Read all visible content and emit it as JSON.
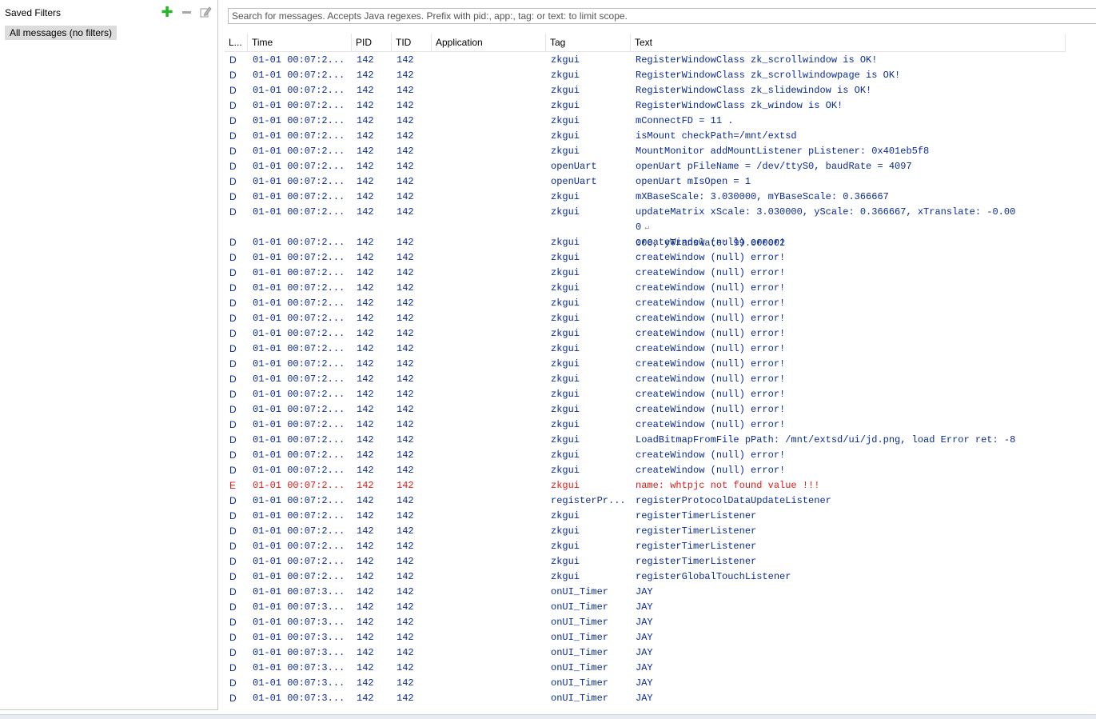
{
  "saved_filters": {
    "title": "Saved Filters",
    "items": [
      "All messages (no filters)"
    ]
  },
  "search": {
    "placeholder": "Search for messages. Accepts Java regexes. Prefix with pid:, app:, tag: or text: to limit scope."
  },
  "columns": {
    "level": "L...",
    "time": "Time",
    "pid": "PID",
    "tid": "TID",
    "application": "Application",
    "tag": "Tag",
    "text": "Text"
  },
  "colors": {
    "debug": "#0a2b96",
    "error": "#e01b1b",
    "add_icon": "#27b327"
  },
  "icons": {
    "add": "plus-icon",
    "remove": "minus-icon",
    "edit": "edit-icon",
    "wrap": "line-wrap-icon"
  },
  "rows": [
    {
      "level": "D",
      "time": "01-01 00:07:2...",
      "pid": "142",
      "tid": "142",
      "app": "",
      "tag": "zkgui",
      "text": "RegisterWindowClass zk_scrollwindow is OK!"
    },
    {
      "level": "D",
      "time": "01-01 00:07:2...",
      "pid": "142",
      "tid": "142",
      "app": "",
      "tag": "zkgui",
      "text": "RegisterWindowClass zk_scrollwindowpage is OK!"
    },
    {
      "level": "D",
      "time": "01-01 00:07:2...",
      "pid": "142",
      "tid": "142",
      "app": "",
      "tag": "zkgui",
      "text": "RegisterWindowClass zk_slidewindow is OK!"
    },
    {
      "level": "D",
      "time": "01-01 00:07:2...",
      "pid": "142",
      "tid": "142",
      "app": "",
      "tag": "zkgui",
      "text": "RegisterWindowClass zk_window is OK!"
    },
    {
      "level": "D",
      "time": "01-01 00:07:2...",
      "pid": "142",
      "tid": "142",
      "app": "",
      "tag": "zkgui",
      "text": "mConnectFD = 11 ."
    },
    {
      "level": "D",
      "time": "01-01 00:07:2...",
      "pid": "142",
      "tid": "142",
      "app": "",
      "tag": "zkgui",
      "text": "isMount checkPath=/mnt/extsd"
    },
    {
      "level": "D",
      "time": "01-01 00:07:2...",
      "pid": "142",
      "tid": "142",
      "app": "",
      "tag": "zkgui",
      "text": "MountMonitor addMountListener pListener: 0x401eb5f8"
    },
    {
      "level": "D",
      "time": "01-01 00:07:2...",
      "pid": "142",
      "tid": "142",
      "app": "",
      "tag": "openUart",
      "text": "openUart pFileName = /dev/ttyS0, baudRate = 4097"
    },
    {
      "level": "D",
      "time": "01-01 00:07:2...",
      "pid": "142",
      "tid": "142",
      "app": "",
      "tag": "openUart",
      "text": "openUart mIsOpen = 1"
    },
    {
      "level": "D",
      "time": "01-01 00:07:2...",
      "pid": "142",
      "tid": "142",
      "app": "",
      "tag": "zkgui",
      "text": "mXBaseScale: 3.030000, mYBaseScale: 0.366667"
    },
    {
      "level": "D",
      "time": "01-01 00:07:2...",
      "pid": "142",
      "tid": "142",
      "app": "",
      "tag": "zkgui",
      "text": "updateMatrix xScale: 3.030000, yScale: 0.366667, xTranslate: -0.000",
      "text2": "000, yTranslate: 99.000002"
    },
    {
      "level": "D",
      "time": "01-01 00:07:2...",
      "pid": "142",
      "tid": "142",
      "app": "",
      "tag": "zkgui",
      "text": "createWindow (null) error!"
    },
    {
      "level": "D",
      "time": "01-01 00:07:2...",
      "pid": "142",
      "tid": "142",
      "app": "",
      "tag": "zkgui",
      "text": "createWindow (null) error!"
    },
    {
      "level": "D",
      "time": "01-01 00:07:2...",
      "pid": "142",
      "tid": "142",
      "app": "",
      "tag": "zkgui",
      "text": "createWindow (null) error!"
    },
    {
      "level": "D",
      "time": "01-01 00:07:2...",
      "pid": "142",
      "tid": "142",
      "app": "",
      "tag": "zkgui",
      "text": "createWindow (null) error!"
    },
    {
      "level": "D",
      "time": "01-01 00:07:2...",
      "pid": "142",
      "tid": "142",
      "app": "",
      "tag": "zkgui",
      "text": "createWindow (null) error!"
    },
    {
      "level": "D",
      "time": "01-01 00:07:2...",
      "pid": "142",
      "tid": "142",
      "app": "",
      "tag": "zkgui",
      "text": "createWindow (null) error!"
    },
    {
      "level": "D",
      "time": "01-01 00:07:2...",
      "pid": "142",
      "tid": "142",
      "app": "",
      "tag": "zkgui",
      "text": "createWindow (null) error!"
    },
    {
      "level": "D",
      "time": "01-01 00:07:2...",
      "pid": "142",
      "tid": "142",
      "app": "",
      "tag": "zkgui",
      "text": "createWindow (null) error!"
    },
    {
      "level": "D",
      "time": "01-01 00:07:2...",
      "pid": "142",
      "tid": "142",
      "app": "",
      "tag": "zkgui",
      "text": "createWindow (null) error!"
    },
    {
      "level": "D",
      "time": "01-01 00:07:2...",
      "pid": "142",
      "tid": "142",
      "app": "",
      "tag": "zkgui",
      "text": "createWindow (null) error!"
    },
    {
      "level": "D",
      "time": "01-01 00:07:2...",
      "pid": "142",
      "tid": "142",
      "app": "",
      "tag": "zkgui",
      "text": "createWindow (null) error!"
    },
    {
      "level": "D",
      "time": "01-01 00:07:2...",
      "pid": "142",
      "tid": "142",
      "app": "",
      "tag": "zkgui",
      "text": "createWindow (null) error!"
    },
    {
      "level": "D",
      "time": "01-01 00:07:2...",
      "pid": "142",
      "tid": "142",
      "app": "",
      "tag": "zkgui",
      "text": "createWindow (null) error!"
    },
    {
      "level": "D",
      "time": "01-01 00:07:2...",
      "pid": "142",
      "tid": "142",
      "app": "",
      "tag": "zkgui",
      "text": "LoadBitmapFromFile pPath: /mnt/extsd/ui/jd.png, load Error ret: -8"
    },
    {
      "level": "D",
      "time": "01-01 00:07:2...",
      "pid": "142",
      "tid": "142",
      "app": "",
      "tag": "zkgui",
      "text": "createWindow (null) error!"
    },
    {
      "level": "D",
      "time": "01-01 00:07:2...",
      "pid": "142",
      "tid": "142",
      "app": "",
      "tag": "zkgui",
      "text": "createWindow (null) error!"
    },
    {
      "level": "E",
      "time": "01-01 00:07:2...",
      "pid": "142",
      "tid": "142",
      "app": "",
      "tag": "zkgui",
      "text": "name: whtpjc not found value !!!"
    },
    {
      "level": "D",
      "time": "01-01 00:07:2...",
      "pid": "142",
      "tid": "142",
      "app": "",
      "tag": "registerPr...",
      "text": "registerProtocolDataUpdateListener"
    },
    {
      "level": "D",
      "time": "01-01 00:07:2...",
      "pid": "142",
      "tid": "142",
      "app": "",
      "tag": "zkgui",
      "text": "registerTimerListener"
    },
    {
      "level": "D",
      "time": "01-01 00:07:2...",
      "pid": "142",
      "tid": "142",
      "app": "",
      "tag": "zkgui",
      "text": "registerTimerListener"
    },
    {
      "level": "D",
      "time": "01-01 00:07:2...",
      "pid": "142",
      "tid": "142",
      "app": "",
      "tag": "zkgui",
      "text": "registerTimerListener"
    },
    {
      "level": "D",
      "time": "01-01 00:07:2...",
      "pid": "142",
      "tid": "142",
      "app": "",
      "tag": "zkgui",
      "text": "registerTimerListener"
    },
    {
      "level": "D",
      "time": "01-01 00:07:2...",
      "pid": "142",
      "tid": "142",
      "app": "",
      "tag": "zkgui",
      "text": "registerGlobalTouchListener"
    },
    {
      "level": "D",
      "time": "01-01 00:07:3...",
      "pid": "142",
      "tid": "142",
      "app": "",
      "tag": "onUI_Timer",
      "text": "JAY"
    },
    {
      "level": "D",
      "time": "01-01 00:07:3...",
      "pid": "142",
      "tid": "142",
      "app": "",
      "tag": "onUI_Timer",
      "text": "JAY"
    },
    {
      "level": "D",
      "time": "01-01 00:07:3...",
      "pid": "142",
      "tid": "142",
      "app": "",
      "tag": "onUI_Timer",
      "text": "JAY"
    },
    {
      "level": "D",
      "time": "01-01 00:07:3...",
      "pid": "142",
      "tid": "142",
      "app": "",
      "tag": "onUI_Timer",
      "text": "JAY"
    },
    {
      "level": "D",
      "time": "01-01 00:07:3...",
      "pid": "142",
      "tid": "142",
      "app": "",
      "tag": "onUI_Timer",
      "text": "JAY"
    },
    {
      "level": "D",
      "time": "01-01 00:07:3...",
      "pid": "142",
      "tid": "142",
      "app": "",
      "tag": "onUI_Timer",
      "text": "JAY"
    },
    {
      "level": "D",
      "time": "01-01 00:07:3...",
      "pid": "142",
      "tid": "142",
      "app": "",
      "tag": "onUI_Timer",
      "text": "JAY"
    },
    {
      "level": "D",
      "time": "01-01 00:07:3...",
      "pid": "142",
      "tid": "142",
      "app": "",
      "tag": "onUI_Timer",
      "text": "JAY"
    }
  ]
}
